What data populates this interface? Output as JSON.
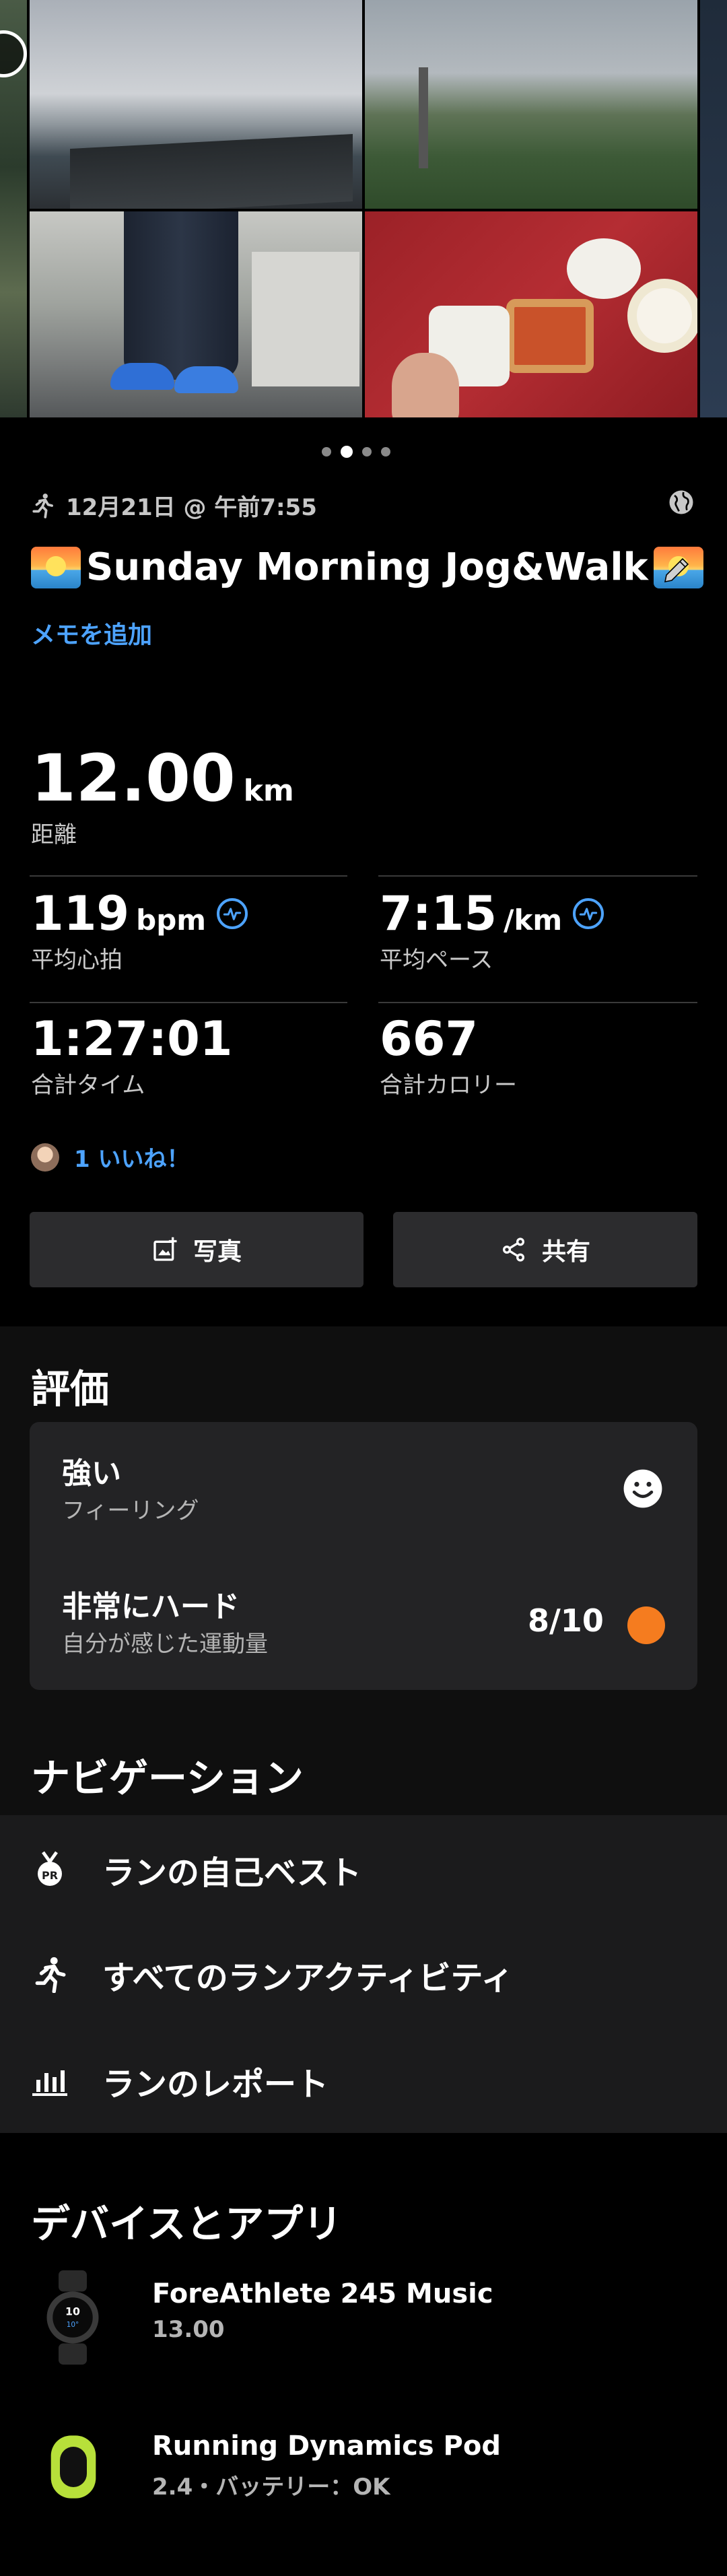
{
  "activity": {
    "date": "12月21日 @ 午前7:55",
    "title": "Sunday Morning Jog&Walk",
    "add_memo": "メモを追加",
    "distance": {
      "value": "12.00",
      "unit": "km",
      "label": "距離"
    },
    "heart_rate": {
      "value": "119",
      "unit": "bpm",
      "label": "平均心拍"
    },
    "pace": {
      "value": "7:15",
      "unit": "/km",
      "label": "平均ペース"
    },
    "total_time": {
      "value": "1:27:01",
      "label": "合計タイム"
    },
    "calories": {
      "value": "667",
      "label": "合計カロリー"
    },
    "likes": "1 いいね！",
    "photo_button": "写真",
    "share_button": "共有",
    "carousel": {
      "count": 4,
      "active_index": 1
    }
  },
  "evaluation": {
    "title": "評価",
    "feeling_value": "強い",
    "feeling_label": "フィーリング",
    "effort_value": "非常にハード",
    "effort_label": "自分が感じた運動量",
    "effort_score": "8/10",
    "effort_color": "#f57c1f"
  },
  "navigation": {
    "title": "ナビゲーション",
    "items": [
      {
        "label": "ランの自己ベスト",
        "icon": "medal-pr-icon"
      },
      {
        "label": "すべてのランアクティビティ",
        "icon": "runner-icon"
      },
      {
        "label": "ランのレポート",
        "icon": "bar-chart-icon"
      }
    ]
  },
  "devices": {
    "title": "デバイスとアプリ",
    "items": [
      {
        "name": "ForeAthlete 245 Music",
        "detail": "13.00",
        "icon": "watch-icon"
      },
      {
        "name": "Running Dynamics Pod",
        "detail": "2.4・バッテリー：OK",
        "icon": "pod-icon"
      }
    ]
  },
  "colors": {
    "accent": "#4da3ff",
    "background": "#000000",
    "card": "#232325",
    "button": "#2c2c2e"
  }
}
